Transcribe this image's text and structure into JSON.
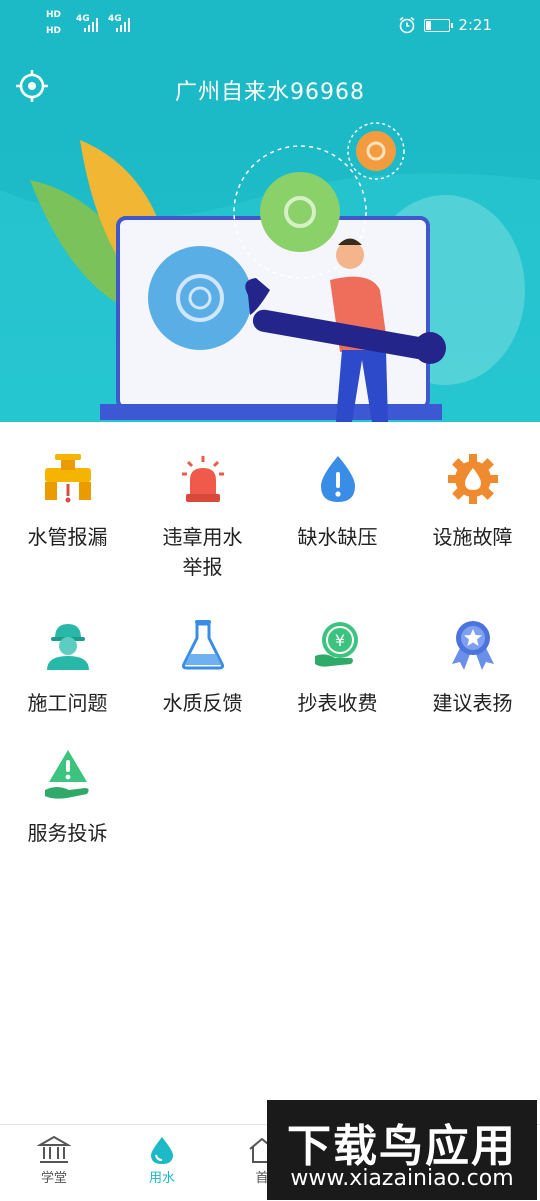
{
  "status": {
    "time": "2:21",
    "network1": "4G",
    "network2": "4G",
    "hd1": "HD",
    "hd2": "HD"
  },
  "header": {
    "title": "广州自来水96968",
    "locate_icon": "locate-icon"
  },
  "colors": {
    "primary": "#1cb9c6",
    "tile_yellow": "#f5b400",
    "tile_red": "#ef5a4a",
    "tile_blue": "#3a8de6",
    "tile_orange": "#f08a2e",
    "tile_green": "#3cc37e"
  },
  "services": [
    {
      "label": "水管报漏",
      "icon": "leaking-pipe-icon"
    },
    {
      "label": "违章用水举报",
      "icon": "alarm-light-icon"
    },
    {
      "label": "缺水缺压",
      "icon": "water-drop-alert-icon"
    },
    {
      "label": "设施故障",
      "icon": "gear-drop-icon"
    },
    {
      "label": "施工问题",
      "icon": "worker-icon"
    },
    {
      "label": "水质反馈",
      "icon": "flask-icon"
    },
    {
      "label": "抄表收费",
      "icon": "yuan-meter-icon"
    },
    {
      "label": "建议表扬",
      "icon": "medal-icon"
    },
    {
      "label": "服务投诉",
      "icon": "hand-warning-icon"
    }
  ],
  "nav": [
    {
      "label": "学堂",
      "icon": "institution-icon",
      "active": false
    },
    {
      "label": "用水",
      "icon": "water-drop-icon",
      "active": true
    },
    {
      "label": "首",
      "icon": "home-icon",
      "active": false
    }
  ],
  "watermark": {
    "title": "下载鸟应用",
    "url": "www.xiazainiao.com"
  }
}
